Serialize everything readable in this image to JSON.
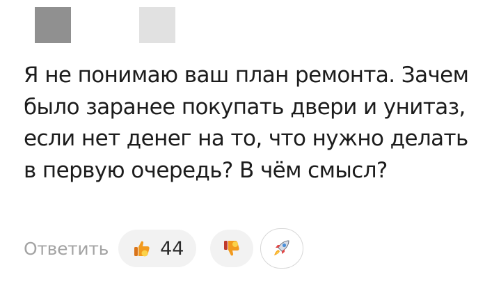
{
  "comment": {
    "text": "Я не понимаю ваш план ремонта. Зачем было заранее покупать двери и унитаз, если нет денег на то, что нужно делать в первую очередь? В чём смысл?"
  },
  "actions": {
    "reply_label": "Ответить",
    "like_count": "44",
    "like_icon": "thumbs-up-icon",
    "dislike_icon": "thumbs-down-icon",
    "boost_icon": "rocket-icon"
  },
  "colors": {
    "text": "#1c1c1c",
    "reply": "#a3a3a3",
    "pill_bg": "#f2f2f2",
    "thumb_orange": "#f29a1e"
  }
}
